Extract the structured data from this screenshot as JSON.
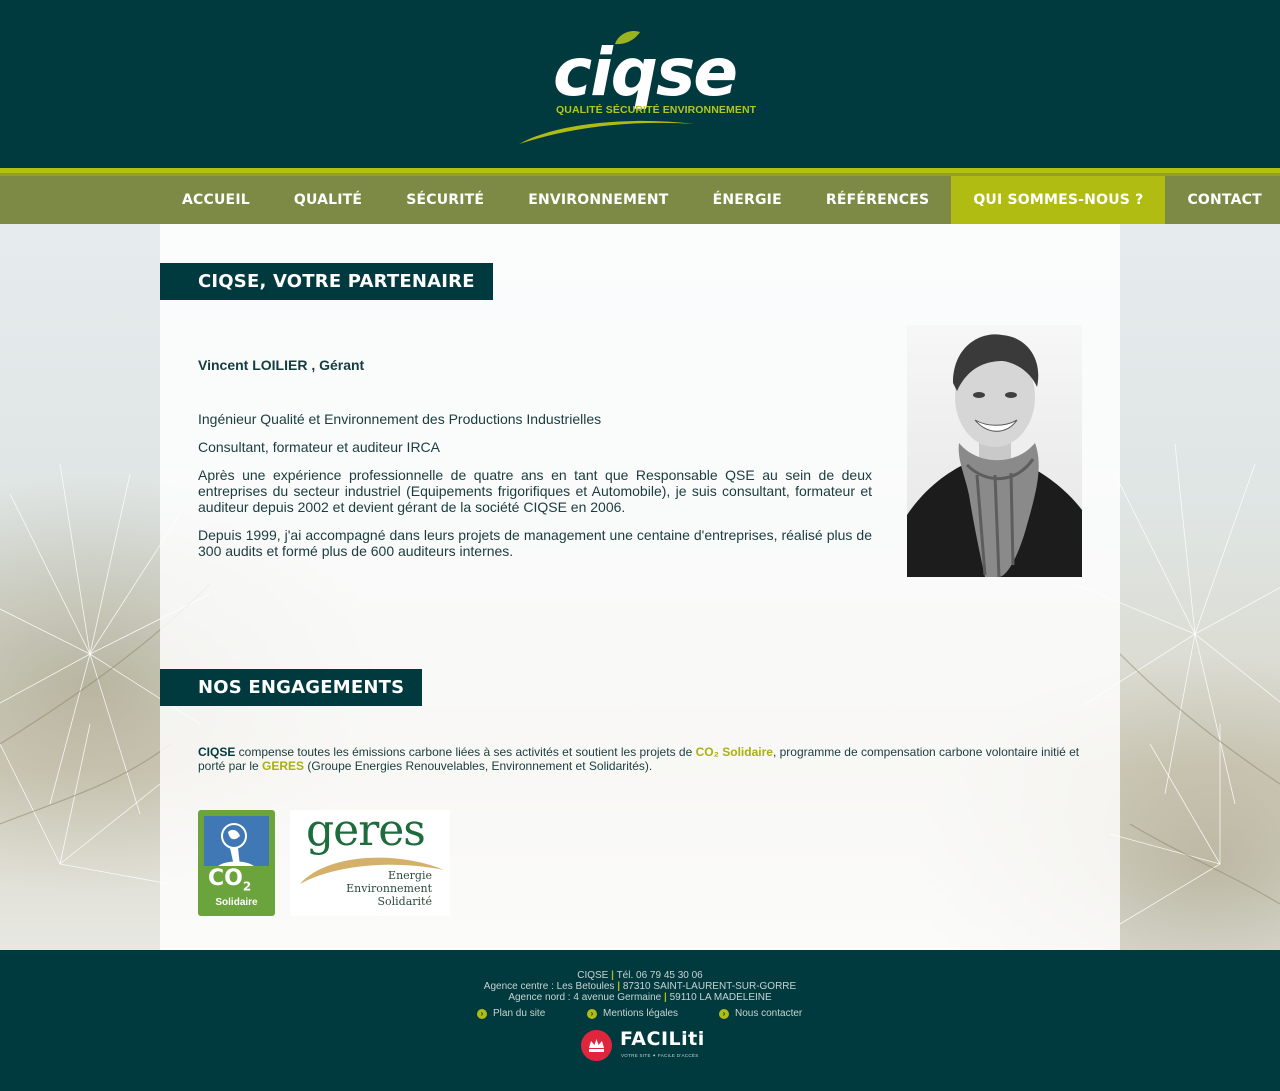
{
  "brand": {
    "logo_text": "ciqse",
    "tagline": "QUALITÉ SÉCURITÉ ENVIRONNEMENT"
  },
  "nav": {
    "items": [
      {
        "label": "ACCUEIL"
      },
      {
        "label": "QUALITÉ"
      },
      {
        "label": "SÉCURITÉ"
      },
      {
        "label": "ENVIRONNEMENT"
      },
      {
        "label": "ÉNERGIE"
      },
      {
        "label": "RÉFÉRENCES"
      },
      {
        "label": "QUI SOMMES-NOUS ?"
      },
      {
        "label": "CONTACT"
      }
    ],
    "active": "QUI SOMMES-NOUS ?"
  },
  "partner": {
    "title": "CIQSE, VOTRE PARTENAIRE",
    "name": "Vincent LOILIER , Gérant",
    "paragraphs": [
      "Ingénieur Qualité et Environnement des Productions Industrielles",
      "Consultant, formateur et auditeur IRCA",
      "Après une expérience professionnelle de quatre ans en tant que Responsable QSE au sein de deux entreprises du secteur industriel (Equipements frigorifiques et Automobile), je suis consultant, formateur et auditeur depuis 2002 et devient gérant de la société CIQSE en 2006.",
      "Depuis 1999, j'ai accompagné dans leurs projets de management une centaine d'entreprises, réalisé plus de 300 audits et formé plus de 600 auditeurs internes."
    ]
  },
  "commitments": {
    "title": "NOS ENGAGEMENTS",
    "text": {
      "ciqse": "CIQSE",
      "part1": " compense toutes les émissions carbone liées à ses activités et soutient les projets de ",
      "co2": "CO₂ Solidaire",
      "part2": ", programme de compensation carbone volontaire initié et porté par le ",
      "geres": "GERES",
      "part3": " (Groupe Energies Renouvelables, Environnement et Solidarités)."
    },
    "co2_logo": {
      "co": "CO",
      "two": "2",
      "label": "Solidaire"
    },
    "geres_logo": {
      "word": "geres",
      "line1": "Energie",
      "line2": "Environnement",
      "line3": "Solidarité"
    }
  },
  "footer": {
    "company": "CIQSE",
    "phone": "Tél. 06 79 45 30 06",
    "agency1_label": "Agence centre : Les Betoules",
    "agency1_city": "87310 SAINT-LAURENT-SUR-GORRE",
    "agency2_label": "Agence nord : 4 avenue Germaine",
    "agency2_city": "59110 LA MADELEINE",
    "links": [
      "Plan du site",
      "Mentions légales",
      "Nous contacter"
    ],
    "faciliti": {
      "word": "FACILiti",
      "sub": "VOTRE SITE ✦ FACILE D'ACCÈS"
    }
  },
  "colors": {
    "dark_teal": "#013a3e",
    "lime": "#b1bc12",
    "nav_olive": "#7c8a45",
    "faciliti_red": "#e0263c"
  }
}
